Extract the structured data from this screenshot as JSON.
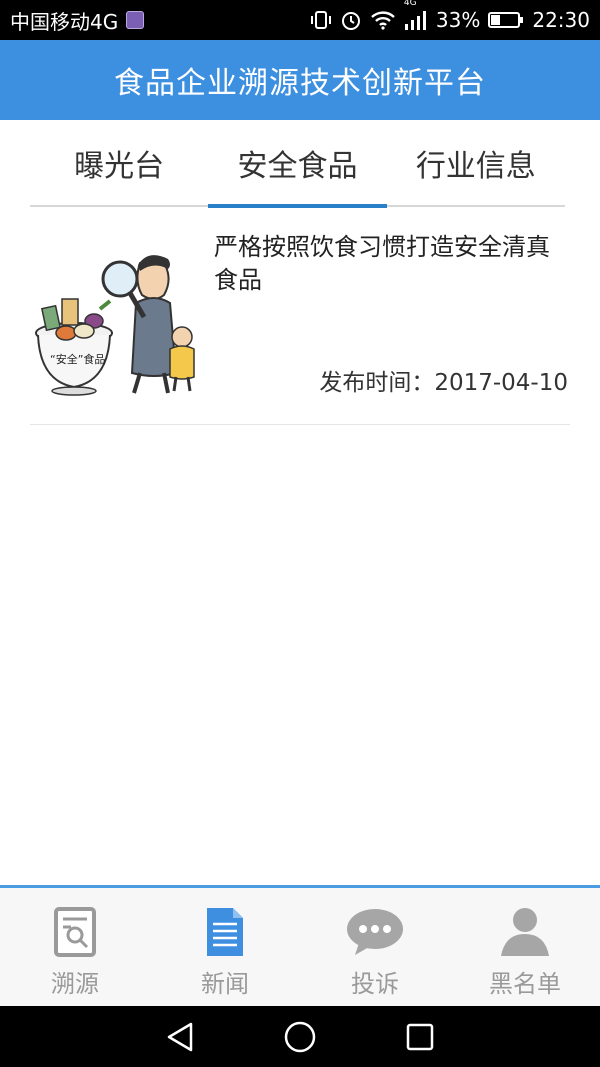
{
  "status_bar": {
    "carrier": "中国移动4G",
    "battery": "33%",
    "time": "22:30",
    "network_badge": "4G"
  },
  "header": {
    "title": "食品企业溯源技术创新平台"
  },
  "tabs": [
    {
      "label": "曝光台",
      "active": false
    },
    {
      "label": "安全食品",
      "active": true
    },
    {
      "label": "行业信息",
      "active": false
    }
  ],
  "news": [
    {
      "title": "严格按照饮食习惯打造安全清真食品",
      "date": "发布时间：2017-04-10",
      "thumb_caption": "“安全”食品"
    }
  ],
  "bottom_nav": [
    {
      "label": "溯源",
      "icon": "document-search-icon"
    },
    {
      "label": "新闻",
      "icon": "news-document-icon",
      "active": true
    },
    {
      "label": "投诉",
      "icon": "chat-bubble-icon"
    },
    {
      "label": "黑名单",
      "icon": "person-icon"
    }
  ],
  "colors": {
    "primary": "#3d8fe0",
    "tab_indicator": "#2a7fc9",
    "nav_active": "#3f8fe0",
    "nav_inactive": "#9a9a9a"
  }
}
